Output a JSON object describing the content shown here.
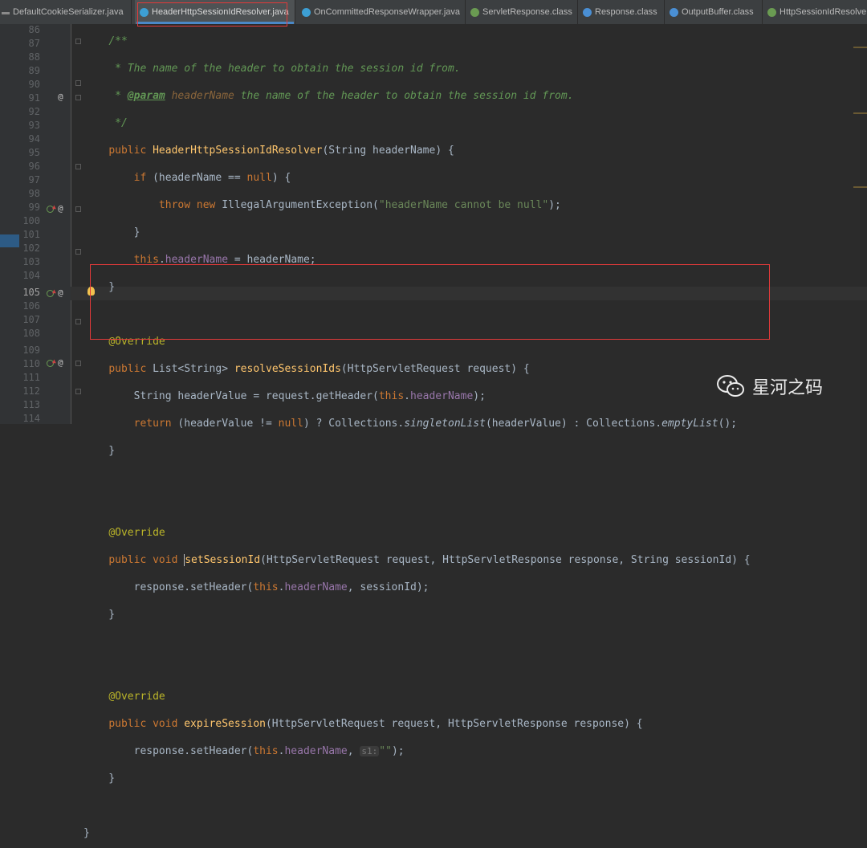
{
  "tabs": [
    {
      "label": "DefaultCookieSerializer.java",
      "icon": "java-class-icon"
    },
    {
      "label": "HeaderHttpSessionIdResolver.java",
      "icon": "java-class-icon",
      "active": true
    },
    {
      "label": "OnCommittedResponseWrapper.java",
      "icon": "java-class-icon"
    },
    {
      "label": "ServletResponse.class",
      "icon": "interface-icon"
    },
    {
      "label": "Response.class",
      "icon": "java-class-icon"
    },
    {
      "label": "OutputBuffer.class",
      "icon": "java-class-icon"
    },
    {
      "label": "HttpSessionIdResolver.",
      "icon": "interface-icon"
    }
  ],
  "editor": {
    "line_numbers": [
      "86",
      "87",
      "88",
      "89",
      "90",
      "91",
      "92",
      "93",
      "94",
      "95",
      "96",
      "97",
      "98",
      "99",
      "100",
      "101",
      "102",
      "103",
      "104",
      "105",
      "106",
      "107",
      "108",
      "109",
      "110",
      "111",
      "112",
      "113",
      "114"
    ],
    "current_line": "105",
    "code": {
      "l87": " * The name of the header to obtain the session id from.",
      "l88_tag": "@param",
      "l88_param": "headerName",
      "l88_rest": " the name of the header to obtain the session id from.",
      "ctor_name": "HeaderHttpSessionIdResolver",
      "exception_msg": "\"headerName cannot be null\"",
      "annotation": "@Override",
      "resolve_name": "resolveSessionIds",
      "set_name": "setSessionId",
      "expire_name": "expireSession",
      "field_name": "headerName",
      "hint": "s1:",
      "empty_str": "\"\""
    }
  },
  "watermark": {
    "text": "星河之码",
    "logo": "wechat-icon"
  },
  "colors": {
    "highlight_box": "#e33a3a",
    "background": "#2b2b2b",
    "keyword": "#cc7832",
    "comment": "#629755",
    "function": "#ffc66d",
    "field": "#9876aa",
    "string": "#6a8759",
    "annotation": "#bbb529"
  }
}
